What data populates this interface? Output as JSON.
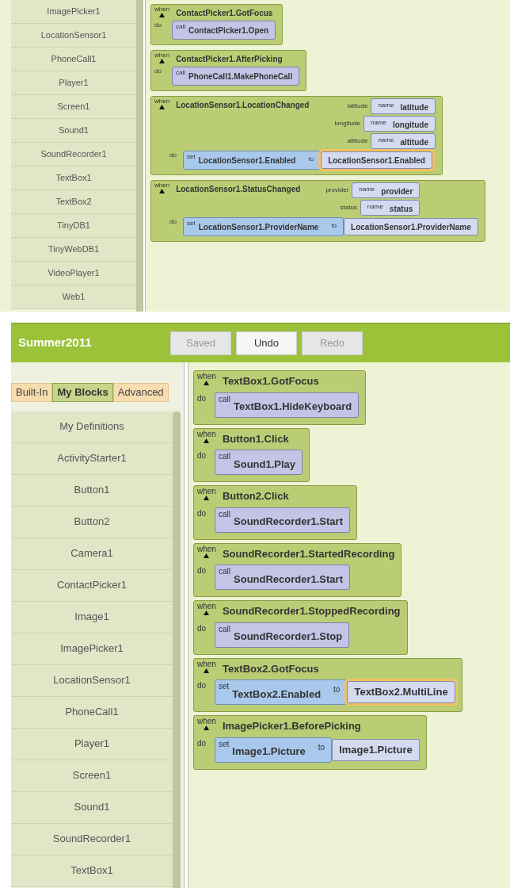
{
  "top_screenshot": {
    "sidebar_items": [
      {
        "label": "ImagePicker1"
      },
      {
        "label": "LocationSensor1"
      },
      {
        "label": "PhoneCall1"
      },
      {
        "label": "Player1"
      },
      {
        "label": "Screen1"
      },
      {
        "label": "Sound1"
      },
      {
        "label": "SoundRecorder1"
      },
      {
        "label": "TextBox1"
      },
      {
        "label": "TextBox2"
      },
      {
        "label": "TinyDB1"
      },
      {
        "label": "TinyWebDB1"
      },
      {
        "label": "VideoPlayer1"
      },
      {
        "label": "Web1"
      }
    ],
    "blocks": [
      {
        "keyword": "when",
        "event": "ContactPicker1.GotFocus",
        "do_label": "do",
        "statements": [
          {
            "kind": "call",
            "keyword": "call",
            "target": "ContactPicker1.Open"
          }
        ]
      },
      {
        "keyword": "when",
        "event": "ContactPicker1.AfterPicking",
        "do_label": "do",
        "statements": [
          {
            "kind": "call",
            "keyword": "call",
            "target": "PhoneCall1.MakePhoneCall"
          }
        ]
      },
      {
        "keyword": "when",
        "event": "LocationSensor1.LocationChanged",
        "params": [
          {
            "label": "latitude",
            "keyword": "name",
            "name": "latitude"
          },
          {
            "label": "longitude",
            "keyword": "name",
            "name": "longitude"
          },
          {
            "label": "altitude",
            "keyword": "name",
            "name": "altitude"
          }
        ],
        "do_label": "do",
        "statements": [
          {
            "kind": "set",
            "keyword": "set",
            "target": "LocationSensor1.Enabled",
            "to_label": "to",
            "value": "LocationSensor1.Enabled",
            "highlighted": true
          }
        ]
      },
      {
        "keyword": "when",
        "event": "LocationSensor1.StatusChanged",
        "params": [
          {
            "label": "provider",
            "keyword": "name",
            "name": "provider"
          },
          {
            "label": "status",
            "keyword": "name",
            "name": "status"
          }
        ],
        "do_label": "do",
        "statements": [
          {
            "kind": "set",
            "keyword": "set",
            "target": "LocationSensor1.ProviderName",
            "to_label": "to",
            "value": "LocationSensor1.ProviderName",
            "highlighted": false
          }
        ]
      }
    ]
  },
  "bottom_screenshot": {
    "header": {
      "title": "Summer2011",
      "buttons": [
        {
          "label": "Saved",
          "disabled": true
        },
        {
          "label": "Undo",
          "disabled": false
        },
        {
          "label": "Redo",
          "disabled": true
        }
      ]
    },
    "tabs": [
      {
        "label": "Built-In",
        "selected": false
      },
      {
        "label": "My Blocks",
        "selected": true
      },
      {
        "label": "Advanced",
        "selected": false
      }
    ],
    "sidebar_items": [
      {
        "label": "My Definitions"
      },
      {
        "label": "ActivityStarter1"
      },
      {
        "label": "Button1"
      },
      {
        "label": "Button2"
      },
      {
        "label": "Camera1"
      },
      {
        "label": "ContactPicker1"
      },
      {
        "label": "Image1"
      },
      {
        "label": "ImagePicker1"
      },
      {
        "label": "LocationSensor1"
      },
      {
        "label": "PhoneCall1"
      },
      {
        "label": "Player1"
      },
      {
        "label": "Screen1"
      },
      {
        "label": "Sound1"
      },
      {
        "label": "SoundRecorder1"
      },
      {
        "label": "TextBox1"
      }
    ],
    "blocks": [
      {
        "keyword": "when",
        "event": "TextBox1.GotFocus",
        "do_label": "do",
        "statements": [
          {
            "kind": "call",
            "keyword": "call",
            "target": "TextBox1.HideKeyboard"
          }
        ]
      },
      {
        "keyword": "when",
        "event": "Button1.Click",
        "do_label": "do",
        "statements": [
          {
            "kind": "call",
            "keyword": "call",
            "target": "Sound1.Play"
          }
        ]
      },
      {
        "keyword": "when",
        "event": "Button2.Click",
        "do_label": "do",
        "statements": [
          {
            "kind": "call",
            "keyword": "call",
            "target": "SoundRecorder1.Start"
          }
        ]
      },
      {
        "keyword": "when",
        "event": "SoundRecorder1.StartedRecording",
        "do_label": "do",
        "statements": [
          {
            "kind": "call",
            "keyword": "call",
            "target": "SoundRecorder1.Start"
          }
        ]
      },
      {
        "keyword": "when",
        "event": "SoundRecorder1.StoppedRecording",
        "do_label": "do",
        "statements": [
          {
            "kind": "call",
            "keyword": "call",
            "target": "SoundRecorder1.Stop"
          }
        ]
      },
      {
        "keyword": "when",
        "event": "TextBox2.GotFocus",
        "do_label": "do",
        "statements": [
          {
            "kind": "set",
            "keyword": "set",
            "target": "TextBox2.Enabled",
            "to_label": "to",
            "value": "TextBox2.MultiLine",
            "highlighted": true
          }
        ]
      },
      {
        "keyword": "when",
        "event": "ImagePicker1.BeforePicking",
        "do_label": "do",
        "statements": [
          {
            "kind": "set",
            "keyword": "set",
            "target": "Image1.Picture",
            "to_label": "to",
            "value": "Image1.Picture",
            "highlighted": false
          }
        ]
      }
    ]
  }
}
